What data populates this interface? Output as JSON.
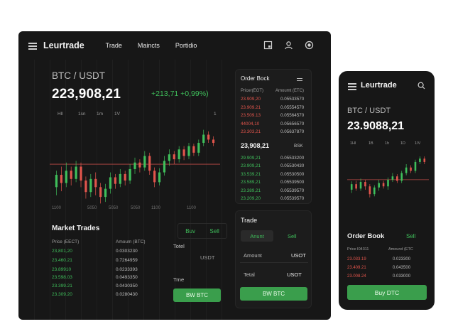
{
  "desktop": {
    "brand": "Leurtrade",
    "nav": [
      "Trade",
      "Maincts",
      "Portidio"
    ],
    "icons": [
      "window-icon",
      "user-icon",
      "eye-icon"
    ],
    "pair": "BTC / USDT",
    "price": "223,908,21",
    "change": "+213,71 +0,99%)",
    "timeframes": [
      "Hll",
      "1sn",
      "1m",
      "1V"
    ],
    "timeframe_extra": "1",
    "x_labels": [
      "1100",
      "5050",
      "5050",
      "1100",
      "1100",
      "5050"
    ],
    "market_trades": {
      "title": "Market Trades",
      "headers": [
        "Price (EECT)",
        "Amoum (BTC)"
      ],
      "rows": [
        {
          "price": "23,801,20",
          "amount": "0.0303230"
        },
        {
          "price": "23.460.21",
          "amount": "0.7264959"
        },
        {
          "price": "23.89910",
          "amount": "0.0233393"
        },
        {
          "price": "23.598.03",
          "amount": "0.0493350"
        },
        {
          "price": "23.399.21",
          "amount": "0.0430350"
        },
        {
          "price": "23.309.20",
          "amount": "0.0280430"
        }
      ]
    },
    "order_form": {
      "buy": "Buv",
      "sell": "Sell",
      "total_label": "Totel",
      "currency": "USDT",
      "time_label": "Trne",
      "button": "BW BTC"
    },
    "order_book": {
      "title": "Order Bock",
      "headers": [
        "Pricer(EGT)",
        "Amoumt (ETC)"
      ],
      "asks": [
        {
          "price": "23.909,20",
          "amount": "0.05533570"
        },
        {
          "price": "23.909.21",
          "amount": "0.05554570"
        },
        {
          "price": "23.509.13",
          "amount": "0.05564570"
        },
        {
          "price": "44004,10",
          "amount": "0.05656570"
        },
        {
          "price": "23.303,21",
          "amount": "0.05637870"
        }
      ],
      "mid_price": "23,908,21",
      "mid_label": "BSK",
      "bids": [
        {
          "price": "29.909,21",
          "amount": "0.05533200"
        },
        {
          "price": "23.909,21",
          "amount": "0.05530430"
        },
        {
          "price": "33.539,21",
          "amount": "0.05530500"
        },
        {
          "price": "23.589,21",
          "amount": "0.05539500"
        },
        {
          "price": "23.389,21",
          "amount": "0.05539570"
        },
        {
          "price": "23.209,20",
          "amount": "0.05539570"
        }
      ]
    },
    "trade": {
      "title": "Trade",
      "tab_active": "Anunt",
      "tab_sell": "Sell",
      "amount_label": "Amount",
      "amount_unit": "USOT",
      "total_label": "Tetal",
      "total_unit": "USOT",
      "button": "BW BTC"
    }
  },
  "mobile": {
    "brand": "Leurtrade",
    "pair": "BTC / USDT",
    "price": "23.9088,21",
    "timeframes": [
      "1Hl",
      "1B",
      "1h",
      "1D",
      "1IV"
    ],
    "order_book": {
      "title": "Order Book",
      "sell": "Sell",
      "headers": [
        "Price I04311",
        "Amound (ETC"
      ],
      "rows": [
        {
          "price": "23.033.19",
          "amount": "0.023300"
        },
        {
          "price": "23.409.21",
          "amount": "0.043500"
        },
        {
          "price": "23.008.24",
          "amount": "0.033000"
        }
      ]
    },
    "button": "Buy DTC"
  },
  "chart_data": {
    "type": "candlestick",
    "reference_line": 23908,
    "candles": [
      {
        "o": 23880,
        "c": 23895,
        "h": 23900,
        "l": 23870
      },
      {
        "o": 23895,
        "c": 23885,
        "h": 23905,
        "l": 23875
      },
      {
        "o": 23885,
        "c": 23900,
        "h": 23910,
        "l": 23880
      },
      {
        "o": 23900,
        "c": 23890,
        "h": 23905,
        "l": 23882
      },
      {
        "o": 23890,
        "c": 23905,
        "h": 23912,
        "l": 23886
      },
      {
        "o": 23905,
        "c": 23888,
        "h": 23910,
        "l": 23880
      },
      {
        "o": 23888,
        "c": 23874,
        "h": 23893,
        "l": 23866
      },
      {
        "o": 23874,
        "c": 23890,
        "h": 23896,
        "l": 23868
      },
      {
        "o": 23890,
        "c": 23880,
        "h": 23898,
        "l": 23870
      },
      {
        "o": 23880,
        "c": 23868,
        "h": 23885,
        "l": 23860
      },
      {
        "o": 23868,
        "c": 23878,
        "h": 23884,
        "l": 23862
      },
      {
        "o": 23878,
        "c": 23892,
        "h": 23898,
        "l": 23872
      },
      {
        "o": 23892,
        "c": 23884,
        "h": 23896,
        "l": 23878
      },
      {
        "o": 23884,
        "c": 23896,
        "h": 23902,
        "l": 23880
      },
      {
        "o": 23896,
        "c": 23888,
        "h": 23900,
        "l": 23882
      },
      {
        "o": 23888,
        "c": 23902,
        "h": 23908,
        "l": 23884
      },
      {
        "o": 23902,
        "c": 23910,
        "h": 23916,
        "l": 23896
      },
      {
        "o": 23910,
        "c": 23904,
        "h": 23914,
        "l": 23898
      },
      {
        "o": 23904,
        "c": 23918,
        "h": 23924,
        "l": 23900
      },
      {
        "o": 23918,
        "c": 23900,
        "h": 23922,
        "l": 23895
      },
      {
        "o": 23900,
        "c": 23886,
        "h": 23904,
        "l": 23880
      },
      {
        "o": 23886,
        "c": 23898,
        "h": 23903,
        "l": 23882
      },
      {
        "o": 23898,
        "c": 23912,
        "h": 23918,
        "l": 23894
      },
      {
        "o": 23912,
        "c": 23920,
        "h": 23926,
        "l": 23906
      },
      {
        "o": 23920,
        "c": 23914,
        "h": 23924,
        "l": 23908
      },
      {
        "o": 23914,
        "c": 23926,
        "h": 23930,
        "l": 23910
      },
      {
        "o": 23926,
        "c": 23918,
        "h": 23930,
        "l": 23913
      },
      {
        "o": 23918,
        "c": 23930,
        "h": 23934,
        "l": 23914
      },
      {
        "o": 23930,
        "c": 23922,
        "h": 23933,
        "l": 23918
      },
      {
        "o": 23922,
        "c": 23934,
        "h": 23938,
        "l": 23918
      },
      {
        "o": 23934,
        "c": 23944,
        "h": 23950,
        "l": 23930
      },
      {
        "o": 23944,
        "c": 23938,
        "h": 23948,
        "l": 23934
      },
      {
        "o": 23938,
        "c": 23934,
        "h": 23942,
        "l": 23930
      }
    ],
    "mobile_candles": [
      {
        "o": 23890,
        "c": 23900,
        "h": 23905,
        "l": 23884
      },
      {
        "o": 23900,
        "c": 23892,
        "h": 23906,
        "l": 23888
      },
      {
        "o": 23892,
        "c": 23904,
        "h": 23910,
        "l": 23888
      },
      {
        "o": 23904,
        "c": 23896,
        "h": 23908,
        "l": 23890
      },
      {
        "o": 23896,
        "c": 23882,
        "h": 23900,
        "l": 23876
      },
      {
        "o": 23882,
        "c": 23894,
        "h": 23898,
        "l": 23878
      },
      {
        "o": 23894,
        "c": 23902,
        "h": 23908,
        "l": 23888
      },
      {
        "o": 23902,
        "c": 23896,
        "h": 23906,
        "l": 23892
      },
      {
        "o": 23896,
        "c": 23908,
        "h": 23912,
        "l": 23890
      },
      {
        "o": 23908,
        "c": 23914,
        "h": 23920,
        "l": 23904
      },
      {
        "o": 23914,
        "c": 23906,
        "h": 23918,
        "l": 23902
      },
      {
        "o": 23906,
        "c": 23920,
        "h": 23924,
        "l": 23902
      },
      {
        "o": 23920,
        "c": 23930,
        "h": 23936,
        "l": 23916
      },
      {
        "o": 23930,
        "c": 23924,
        "h": 23934,
        "l": 23920
      },
      {
        "o": 23924,
        "c": 23940,
        "h": 23944,
        "l": 23920
      },
      {
        "o": 23940,
        "c": 23946,
        "h": 23950,
        "l": 23936
      },
      {
        "o": 23946,
        "c": 23940,
        "h": 23950,
        "l": 23936
      }
    ],
    "colors": {
      "up": "#3fbf5b",
      "down": "#e2554c",
      "line": "#b84a44"
    }
  }
}
